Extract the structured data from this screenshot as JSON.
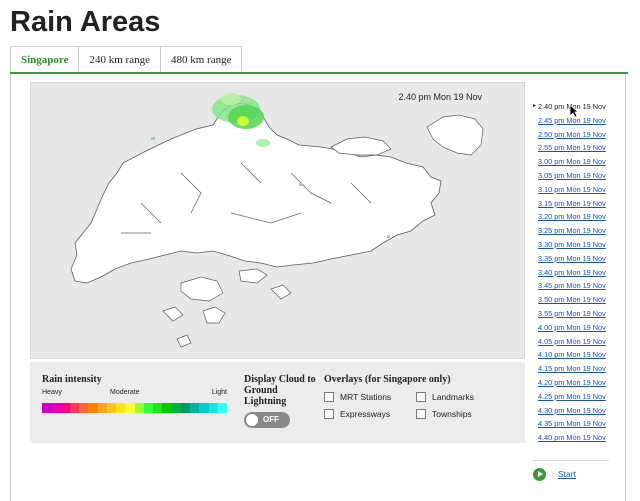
{
  "title": "Rain Areas",
  "tabs": [
    {
      "label": "Singapore",
      "active": true
    },
    {
      "label": "240 km range",
      "active": false
    },
    {
      "label": "480 km range",
      "active": false
    }
  ],
  "map": {
    "timestamp": "2.40 pm Mon 19 Nov"
  },
  "legend": {
    "title": "Rain intensity",
    "heavy": "Heavy",
    "moderate": "Moderate",
    "light": "Light",
    "colors": [
      "#cc00cc",
      "#e600b3",
      "#ff0080",
      "#ff3355",
      "#ff6633",
      "#ff8000",
      "#ffa31a",
      "#ffc61a",
      "#ffe51a",
      "#ffff33",
      "#99ff33",
      "#33ff33",
      "#1ae61a",
      "#00cc00",
      "#00b33c",
      "#009966",
      "#00b3a3",
      "#00cccc",
      "#1ae6e6",
      "#33ffff"
    ]
  },
  "cloud": {
    "title": "Display Cloud to Ground Lightning",
    "toggle_label": "OFF"
  },
  "overlays": {
    "title": "Overlays (for Singapore only)",
    "items": [
      {
        "label": "MRT Stations"
      },
      {
        "label": "Landmarks"
      },
      {
        "label": "Expressways"
      },
      {
        "label": "Townships"
      }
    ]
  },
  "times": [
    "2.40 pm Mon 19 Nov",
    "2.45 pm Mon 19 Nov",
    "2.50 pm Mon 19 Nov",
    "2.55 pm Mon 19 Nov",
    "3.00 pm Mon 19 Nov",
    "3.05 pm Mon 19 Nov",
    "3.10 pm Mon 19 Nov",
    "3.15 pm Mon 19 Nov",
    "3.20 pm Mon 19 Nov",
    "3.25 pm Mon 19 Nov",
    "3.30 pm Mon 19 Nov",
    "3.35 pm Mon 19 Nov",
    "3.40 pm Mon 19 Nov",
    "3.45 pm Mon 19 Nov",
    "3.50 pm Mon 19 Nov",
    "3.55 pm Mon 19 Nov",
    "4.00 pm Mon 19 Nov",
    "4.05 pm Mon 19 Nov",
    "4.10 pm Mon 19 Nov",
    "4.15 pm Mon 19 Nov",
    "4.20 pm Mon 19 Nov",
    "4.25 pm Mon 19 Nov",
    "4.30 pm Mon 19 Nov",
    "4.35 pm Mon 19 Nov",
    "4.40 pm Mon 19 Nov"
  ],
  "current_time_index": 0,
  "controls": {
    "start_label": "Start",
    "play_icon": "play-icon"
  }
}
